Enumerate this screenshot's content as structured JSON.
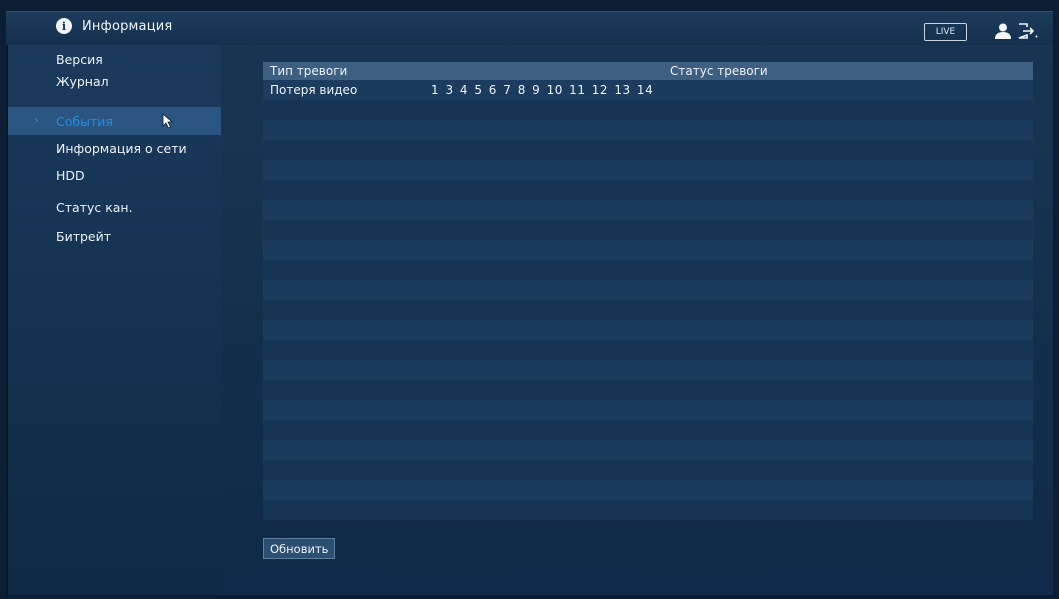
{
  "header": {
    "title": "Информация",
    "live_label": "LIVE",
    "icons": [
      "info-icon",
      "user-icon",
      "logout-icon"
    ]
  },
  "sidebar": {
    "items": [
      {
        "label": "Версия",
        "active": false
      },
      {
        "label": "Журнал",
        "active": false
      },
      {
        "label": "События",
        "active": true
      },
      {
        "label": "Информация о сети",
        "active": false
      },
      {
        "label": "HDD",
        "active": false
      },
      {
        "label": "Статус кан.",
        "active": false
      },
      {
        "label": "Битрейт",
        "active": false
      }
    ]
  },
  "table": {
    "columns": [
      "Тип тревоги",
      "Статус тревоги"
    ],
    "rows": [
      {
        "type": "Потеря видео",
        "status": "1 3 4 5 6 7 8 9 10 11 12 13 14"
      }
    ],
    "empty_rows": 21
  },
  "actions": {
    "refresh_label": "Обновить"
  },
  "colors": {
    "accent": "#1e8fe6",
    "panel": "#132f4c",
    "header_row": "#3d5f82"
  }
}
